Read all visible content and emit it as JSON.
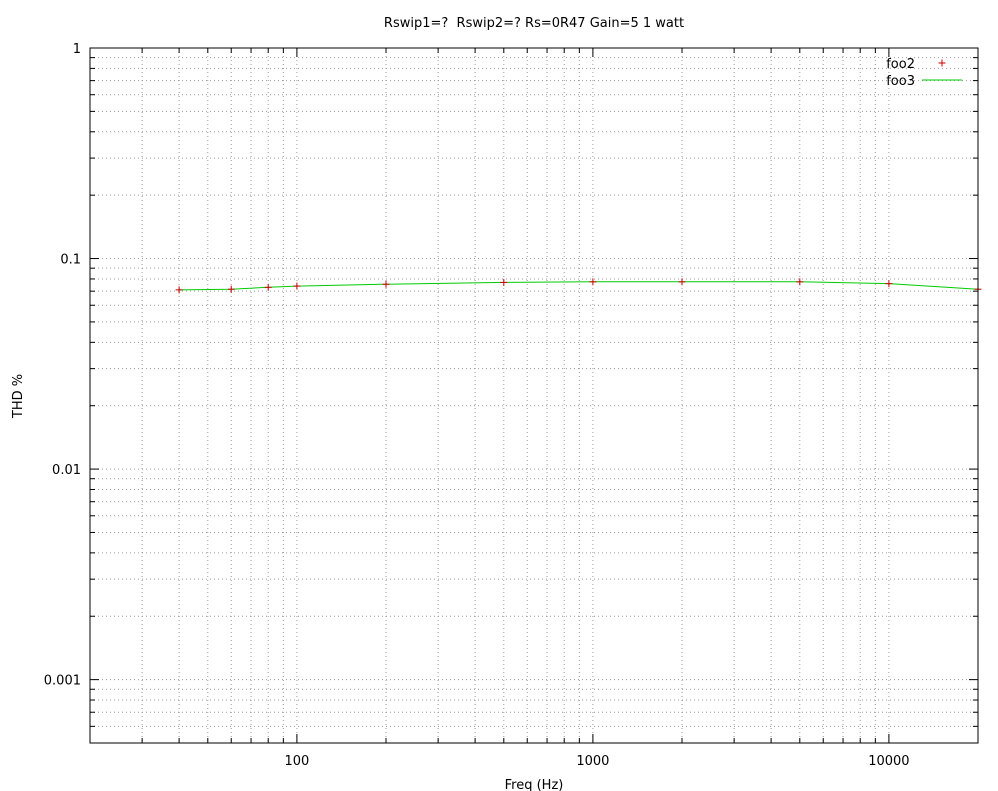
{
  "chart_data": {
    "type": "line",
    "title": "Rswip1=?  Rswip2=? Rs=0R47 Gain=5 1 watt",
    "xlabel": "Freq (Hz)",
    "ylabel": "THD %",
    "x_scale": "log",
    "y_scale": "log",
    "xlim": [
      20,
      20000
    ],
    "ylim": [
      0.0005,
      1
    ],
    "grid": true,
    "legend_position": "top-right",
    "x_tick_labels": [
      {
        "value": 100,
        "label": "100"
      },
      {
        "value": 1000,
        "label": "1000"
      },
      {
        "value": 10000,
        "label": "10000"
      }
    ],
    "y_tick_labels": [
      {
        "value": 1,
        "label": "1"
      },
      {
        "value": 0.1,
        "label": "0.1"
      },
      {
        "value": 0.01,
        "label": "0.01"
      },
      {
        "value": 0.001,
        "label": "0.001"
      }
    ],
    "series": [
      {
        "name": "foo2",
        "style": "points",
        "marker": "+",
        "color": "#cc0000",
        "x": [
          40,
          60,
          80,
          100,
          200,
          500,
          1000,
          2000,
          5000,
          10000,
          20000
        ],
        "y": [
          0.071,
          0.0715,
          0.073,
          0.074,
          0.0755,
          0.077,
          0.0775,
          0.0775,
          0.0775,
          0.076,
          0.0715
        ]
      },
      {
        "name": "foo3",
        "style": "line",
        "color": "#00cc00",
        "x": [
          40,
          60,
          80,
          100,
          200,
          500,
          1000,
          2000,
          5000,
          10000,
          20000
        ],
        "y": [
          0.071,
          0.0715,
          0.073,
          0.074,
          0.0755,
          0.077,
          0.0775,
          0.0775,
          0.0775,
          0.076,
          0.0715
        ]
      }
    ]
  }
}
